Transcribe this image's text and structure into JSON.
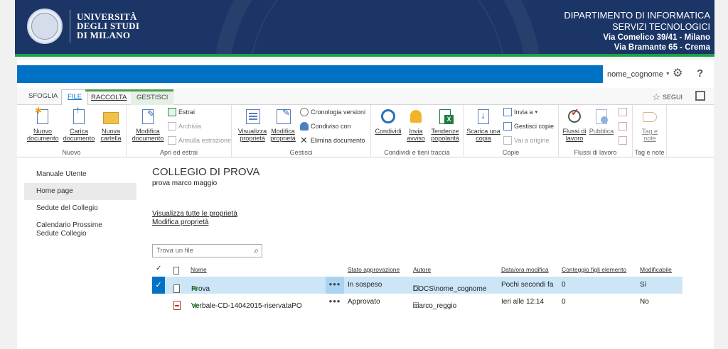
{
  "banner": {
    "uni_line1": "UNIVERSITÀ",
    "uni_line2": "DEGLI STUDI",
    "uni_line3": "DI MILANO",
    "dept_line1": "DIPARTIMENTO DI INFORMATICA",
    "dept_line2": "SERVIZI TECNOLOGICI",
    "dept_line3": "Via Comelico 39/41 - Milano",
    "dept_line4": "Via Bramante 65 - Crema"
  },
  "suitebar": {
    "username": "nome_cognome",
    "gear_icon": "gear-icon",
    "help_label": "?"
  },
  "tabs": {
    "sfoglia": "SFOGLIA",
    "file": "FILE",
    "raccolta": "RACCOLTA",
    "gestisci": "GESTISCI",
    "segui": "SEGUI"
  },
  "ribbon": {
    "nuovo": {
      "title": "Nuovo",
      "nuovo_doc1": "Nuovo",
      "nuovo_doc2": "documento",
      "carica1": "Carica",
      "carica2": "documento",
      "cartella1": "Nuova",
      "cartella2": "cartella"
    },
    "apri": {
      "title": "Apri ed estrai",
      "modifica1": "Modifica",
      "modifica2": "documento",
      "estrai": "Estrai",
      "archivia": "Archivia",
      "annulla": "Annulla estrazione"
    },
    "gestisci": {
      "title": "Gestisci",
      "vis1": "Visualizza",
      "vis2": "proprietà",
      "mod1": "Modifica",
      "mod2": "proprietà",
      "cronologia": "Cronologia versioni",
      "condiviso": "Condiviso con",
      "elimina": "Elimina documento"
    },
    "condividi": {
      "title": "Condividi e tieni traccia",
      "condividi": "Condividi",
      "invia1": "Invia",
      "invia2": "avviso",
      "tend1": "Tendenze",
      "tend2": "popolarità"
    },
    "copie": {
      "title": "Copie",
      "scarica1": "Scarica una",
      "scarica2": "copia",
      "inviaa": "Invia a",
      "gestisci_copie": "Gestisci copie",
      "vai": "Vai a origine"
    },
    "flussi": {
      "title": "Flussi di lavoro",
      "flussi1": "Flussi di",
      "flussi2": "lavoro",
      "pubblica": "Pubblica"
    },
    "tag": {
      "title": "Tag e note",
      "tag1": "Tag e",
      "tag2": "note"
    }
  },
  "leftnav": {
    "items": [
      "Manuale Utente",
      "Home page",
      "Sedute del Collegio",
      "Calendario Prossime Sedute Collegio"
    ]
  },
  "main": {
    "title": "COLLEGIO DI PROVA",
    "subtitle": "prova marco maggio",
    "link_view_props": "Visualizza tutte le proprietà",
    "link_edit_props": "Modifica proprietà",
    "search_placeholder": "Trova un file"
  },
  "grid": {
    "headers": {
      "nome": "Nome",
      "stato": "Stato approvazione",
      "autore": "Autore",
      "data": "Data/ora modifica",
      "conteggio": "Conteggio figli elemento",
      "modificabile": "Modificabile"
    },
    "rows": [
      {
        "nome": "Prova",
        "stato": "In sospeso",
        "autore": "DOCS\\nome_cognome",
        "data": "Pochi secondi fa",
        "conteggio": "0",
        "modificabile": "Sì"
      },
      {
        "nome": "Verbale-CD-14042015-riservataPO",
        "stato": "Approvato",
        "autore": "marco_reggio",
        "data": "Ieri alle 12:14",
        "conteggio": "0",
        "modificabile": "No"
      }
    ]
  },
  "colors": {
    "banner": "#1b3566",
    "accent": "#0072c6",
    "green": "#1aa24a",
    "selected_row": "#cde6f7"
  }
}
